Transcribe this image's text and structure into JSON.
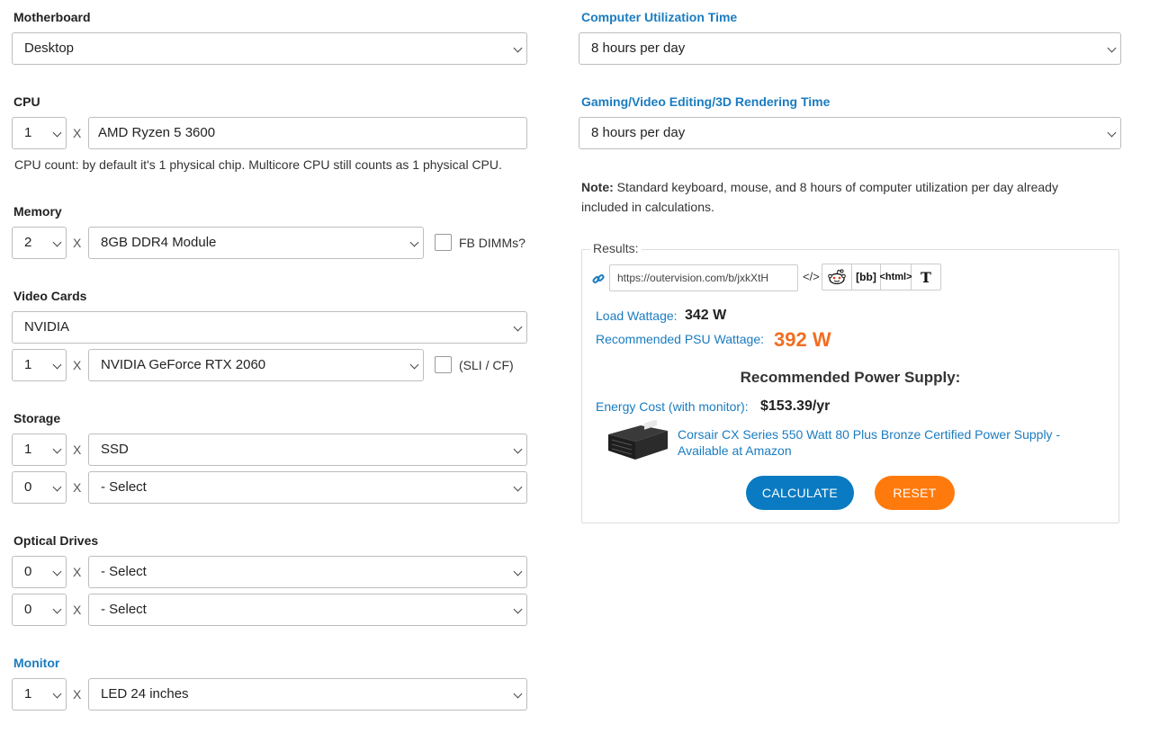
{
  "left": {
    "motherboard": {
      "label": "Motherboard",
      "value": "Desktop"
    },
    "cpu": {
      "label": "CPU",
      "count": "1",
      "value": "AMD Ryzen 5 3600",
      "note": "CPU count: by default it's 1 physical chip. Multicore CPU still counts as 1 physical CPU."
    },
    "memory": {
      "label": "Memory",
      "count": "2",
      "value": "8GB DDR4 Module",
      "checkbox_label": "FB DIMMs?"
    },
    "video": {
      "label": "Video Cards",
      "brand": "NVIDIA",
      "count": "1",
      "value": "NVIDIA GeForce RTX 2060",
      "checkbox_label": "(SLI / CF)"
    },
    "storage": {
      "label": "Storage",
      "rows": [
        {
          "count": "1",
          "value": "SSD"
        },
        {
          "count": "0",
          "value": "- Select"
        }
      ]
    },
    "optical": {
      "label": "Optical Drives",
      "rows": [
        {
          "count": "0",
          "value": "- Select"
        },
        {
          "count": "0",
          "value": "- Select"
        }
      ]
    },
    "monitor": {
      "label": "Monitor",
      "count": "1",
      "value": "LED 24 inches"
    },
    "times_symbol": "X"
  },
  "right": {
    "util": {
      "label": "Computer Utilization Time",
      "value": "8 hours per day"
    },
    "gaming": {
      "label": "Gaming/Video Editing/3D Rendering Time",
      "value": "8 hours per day"
    },
    "note": {
      "bold": "Note:",
      "line1": " Standard keyboard, mouse, and 8 hours of computer utilization per day already",
      "line2": "included in calculations."
    },
    "results": {
      "legend": "Results:",
      "share_url": "https://outervision.com/b/jxkXtH",
      "icons": {
        "embed": "</>",
        "bb": "[bb]",
        "html": "<html>",
        "text": "T"
      },
      "load_label": "Load Wattage:",
      "load_value": "342 W",
      "psu_label": "Recommended PSU Wattage:",
      "psu_value": "392 W",
      "rec_heading": "Recommended Power Supply:",
      "energy_label": "Energy Cost (with monitor):",
      "energy_value": "$153.39/yr",
      "product_line1": "Corsair CX Series 550 Watt 80 Plus Bronze Certified Power Supply -",
      "product_line2": "Available at Amazon",
      "calculate": "CALCULATE",
      "reset": "RESET"
    }
  },
  "colors": {
    "accent_blue": "#1a7cc0",
    "calc_button": "#0a7bc2",
    "reset_button": "#ff7a0d",
    "psu_value": "#f26d21"
  }
}
